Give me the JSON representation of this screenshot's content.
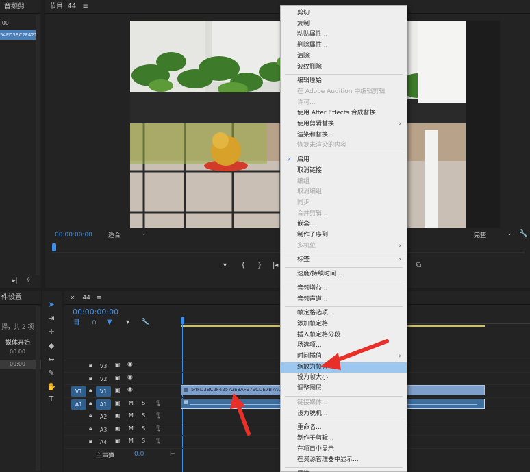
{
  "app": {
    "media_panel_title": "音频剪",
    "program_panel_title": "节目: 44",
    "panel_menu_icon": "hamburger-icon"
  },
  "left_panel": {
    "timecode": ":00",
    "clip_name": "54FD3BC2F421",
    "bottom_title": "件设置",
    "bottom_info": "择，共 2 项",
    "bottom_sub": "媒体开始",
    "bottom_tc1": "00:00",
    "bottom_tc2": "00:00"
  },
  "program_monitor": {
    "timecode": "00:00:00:00",
    "fit_select": "适合",
    "quality_select": "完整",
    "wrench_icon": "wrench-icon"
  },
  "timeline": {
    "tab_label": "44",
    "timecode": "00:00:00:00",
    "clip_name": "54FD3BC2F42572E3AF979CDE7B7ACCE.m",
    "audio_clip_icon": "fx-badge",
    "tracks": [
      {
        "source": "",
        "name": "V3",
        "type": "video"
      },
      {
        "source": "",
        "name": "V2",
        "type": "video"
      },
      {
        "source": "V1",
        "name": "V1",
        "type": "video"
      },
      {
        "source": "A1",
        "name": "A1",
        "type": "audio"
      },
      {
        "source": "",
        "name": "A2",
        "type": "audio"
      },
      {
        "source": "",
        "name": "A3",
        "type": "audio"
      },
      {
        "source": "",
        "name": "A4",
        "type": "audio"
      }
    ],
    "master_label": "主声道",
    "master_value": "0.0",
    "track_toggle_m": "M",
    "track_toggle_s": "S"
  },
  "context_menu": {
    "items": [
      {
        "label": "剪切",
        "disabled": false
      },
      {
        "label": "复制",
        "disabled": false
      },
      {
        "label": "粘贴属性...",
        "disabled": false
      },
      {
        "label": "删除属性...",
        "disabled": false
      },
      {
        "label": "清除",
        "disabled": false
      },
      {
        "label": "波纹删除",
        "disabled": false,
        "sep_after": true
      },
      {
        "label": "编辑原始",
        "disabled": false
      },
      {
        "label": "在 Adobe Audition 中编辑剪辑",
        "disabled": true
      },
      {
        "label": "许可...",
        "disabled": true
      },
      {
        "label": "使用 After Effects 合成替换",
        "disabled": false
      },
      {
        "label": "使用剪辑替换",
        "disabled": false,
        "submenu": true
      },
      {
        "label": "渲染和替换...",
        "disabled": false
      },
      {
        "label": "恢复未渲染的内容",
        "disabled": true,
        "sep_after": true
      },
      {
        "label": "启用",
        "disabled": false,
        "checked": true
      },
      {
        "label": "取消链接",
        "disabled": false
      },
      {
        "label": "编组",
        "disabled": true
      },
      {
        "label": "取消编组",
        "disabled": true
      },
      {
        "label": "同步",
        "disabled": true
      },
      {
        "label": "合并剪辑...",
        "disabled": true
      },
      {
        "label": "嵌套...",
        "disabled": false
      },
      {
        "label": "制作子序列",
        "disabled": false
      },
      {
        "label": "多机位",
        "disabled": true,
        "submenu": true,
        "sep_after": true
      },
      {
        "label": "标签",
        "disabled": false,
        "submenu": true,
        "sep_after": true
      },
      {
        "label": "速度/持续时间...",
        "disabled": false,
        "sep_after": true
      },
      {
        "label": "音频增益...",
        "disabled": false
      },
      {
        "label": "音频声道...",
        "disabled": false,
        "sep_after": true
      },
      {
        "label": "帧定格选项...",
        "disabled": false
      },
      {
        "label": "添加帧定格",
        "disabled": false
      },
      {
        "label": "插入帧定格分段",
        "disabled": false
      },
      {
        "label": "场选项...",
        "disabled": false
      },
      {
        "label": "时间插值",
        "disabled": false,
        "submenu": true
      },
      {
        "label": "缩放为帧大小",
        "disabled": false,
        "highlighted": true
      },
      {
        "label": "设为帧大小",
        "disabled": false
      },
      {
        "label": "调整图层",
        "disabled": false,
        "sep_after": true
      },
      {
        "label": "链接媒体...",
        "disabled": true
      },
      {
        "label": "设为脱机...",
        "disabled": false,
        "sep_after": true
      },
      {
        "label": "重命名...",
        "disabled": false
      },
      {
        "label": "制作子剪辑...",
        "disabled": false
      },
      {
        "label": "在项目中显示",
        "disabled": false
      },
      {
        "label": "在资源管理器中显示...",
        "disabled": false,
        "sep_after": true
      },
      {
        "label": "属性",
        "disabled": false
      }
    ]
  },
  "colors": {
    "accent": "#3d8ee8",
    "video_clip": "#7f9fcb",
    "audio_clip": "#3e6e9e",
    "menu_highlight": "#9cc7ee",
    "annotation_arrow": "#e8302a"
  }
}
